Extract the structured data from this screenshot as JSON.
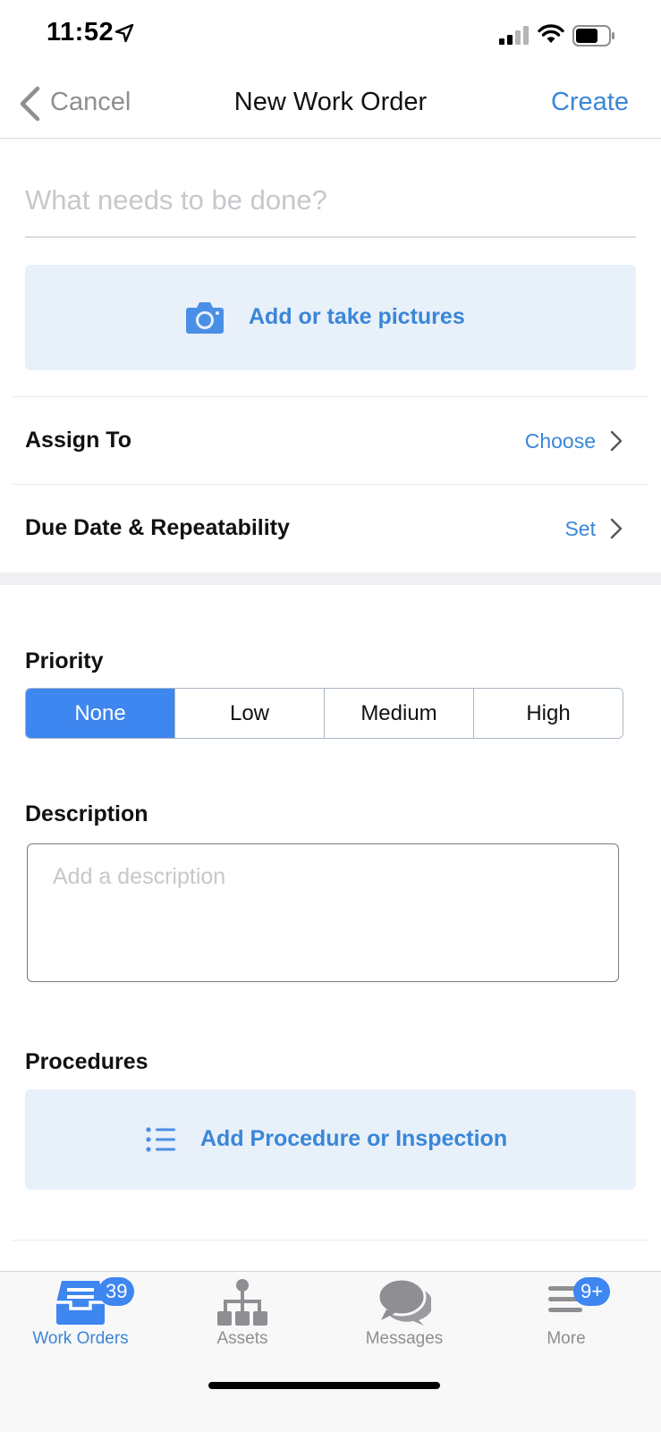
{
  "status_bar": {
    "time": "11:52"
  },
  "nav": {
    "back_label": "Cancel",
    "title": "New Work Order",
    "action_label": "Create"
  },
  "title_field": {
    "placeholder": "What needs to be done?",
    "value": ""
  },
  "pictures": {
    "label": "Add or take pictures",
    "icon": "camera-icon"
  },
  "rows": {
    "assign_to": {
      "label": "Assign To",
      "value": "Choose"
    },
    "due_date": {
      "label": "Due Date & Repeatability",
      "value": "Set"
    }
  },
  "priority": {
    "label": "Priority",
    "options": [
      "None",
      "Low",
      "Medium",
      "High"
    ],
    "selected": "None"
  },
  "description": {
    "label": "Description",
    "placeholder": "Add a description",
    "value": ""
  },
  "procedures": {
    "label": "Procedures",
    "button_label": "Add Procedure or Inspection",
    "icon": "list-icon"
  },
  "tabbar": {
    "tabs": [
      {
        "label": "Work Orders",
        "icon": "inbox-tray-icon",
        "badge": "39",
        "active": true
      },
      {
        "label": "Assets",
        "icon": "hierarchy-icon",
        "badge": "",
        "active": false
      },
      {
        "label": "Messages",
        "icon": "chat-bubbles-icon",
        "badge": "",
        "active": false
      },
      {
        "label": "More",
        "icon": "menu-lines-icon",
        "badge": "9+",
        "active": false
      }
    ]
  },
  "colors": {
    "accent": "#3a86d8",
    "segment_active": "#3e86f0",
    "tile_background": "#e8f0fa"
  }
}
